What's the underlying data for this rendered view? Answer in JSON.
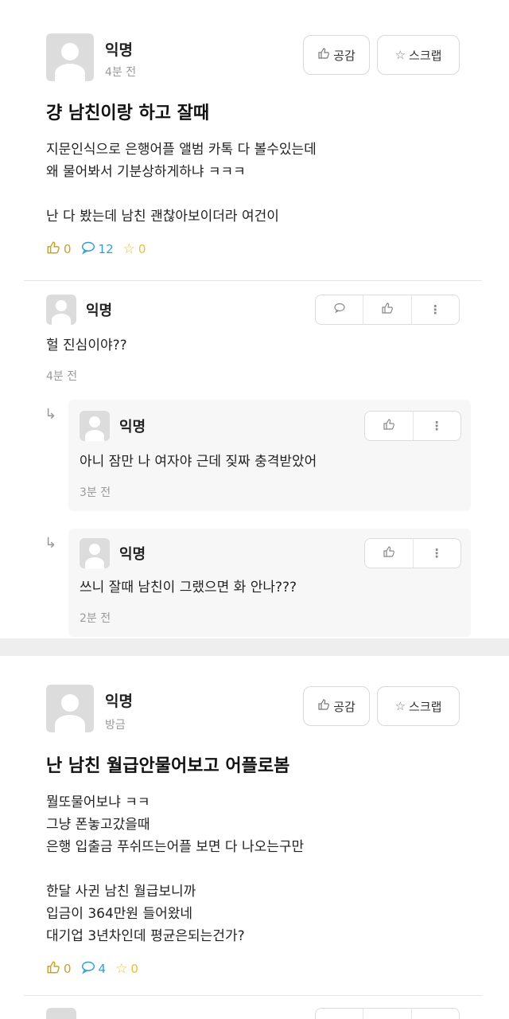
{
  "post1": {
    "author": "익명",
    "time": "4분 전",
    "like_label": "공감",
    "scrap_label": "스크랩",
    "title": "걍 남친이랑 하고 잘때",
    "body": [
      "지문인식으로 은행어플 앨범 카톡 다 볼수있는데",
      "왜 물어봐서 기분상하게하냐 ㅋㅋㅋ",
      "",
      "난 다 봤는데 남친 괜찮아보이더라 여건이"
    ],
    "likes": "0",
    "comments": "12",
    "scraps": "0"
  },
  "comment1": {
    "author": "익명",
    "text": "헐 진심이야??",
    "time": "4분 전"
  },
  "reply1": {
    "author": "익명",
    "text": "아니 잠만 나 여자야 근데 짖짜 충격받았어",
    "time": "3분 전"
  },
  "reply2": {
    "author": "익명",
    "text": "쓰니 잘때 남친이 그랬으면 화 안나???",
    "time": "2분 전"
  },
  "post2": {
    "author": "익명",
    "time": "방금",
    "like_label": "공감",
    "scrap_label": "스크랩",
    "title": "난 남친 월급안물어보고 어플로봄",
    "body": [
      "뭘또물어보냐 ㅋㅋ",
      "그냥 폰놓고갔을때",
      "은행 입출금 푸쉬뜨는어플 보면 다 나오는구만",
      "",
      "한달 사귄 남친 월급보니까",
      "입금이 364만원 들어왔네",
      "대기업 3년차인데 평균은되는건가?"
    ],
    "likes": "0",
    "comments": "4",
    "scraps": "0"
  },
  "icons": {
    "like": "thumbs-up-icon",
    "comment": "speech-bubble-icon",
    "scrap": "star-icon",
    "more": "vertical-dots-icon",
    "reply": "reply-arrow-icon"
  },
  "colors": {
    "like": "#c9a227",
    "comment": "#2f9fd6",
    "scrap": "#e8c13a"
  }
}
